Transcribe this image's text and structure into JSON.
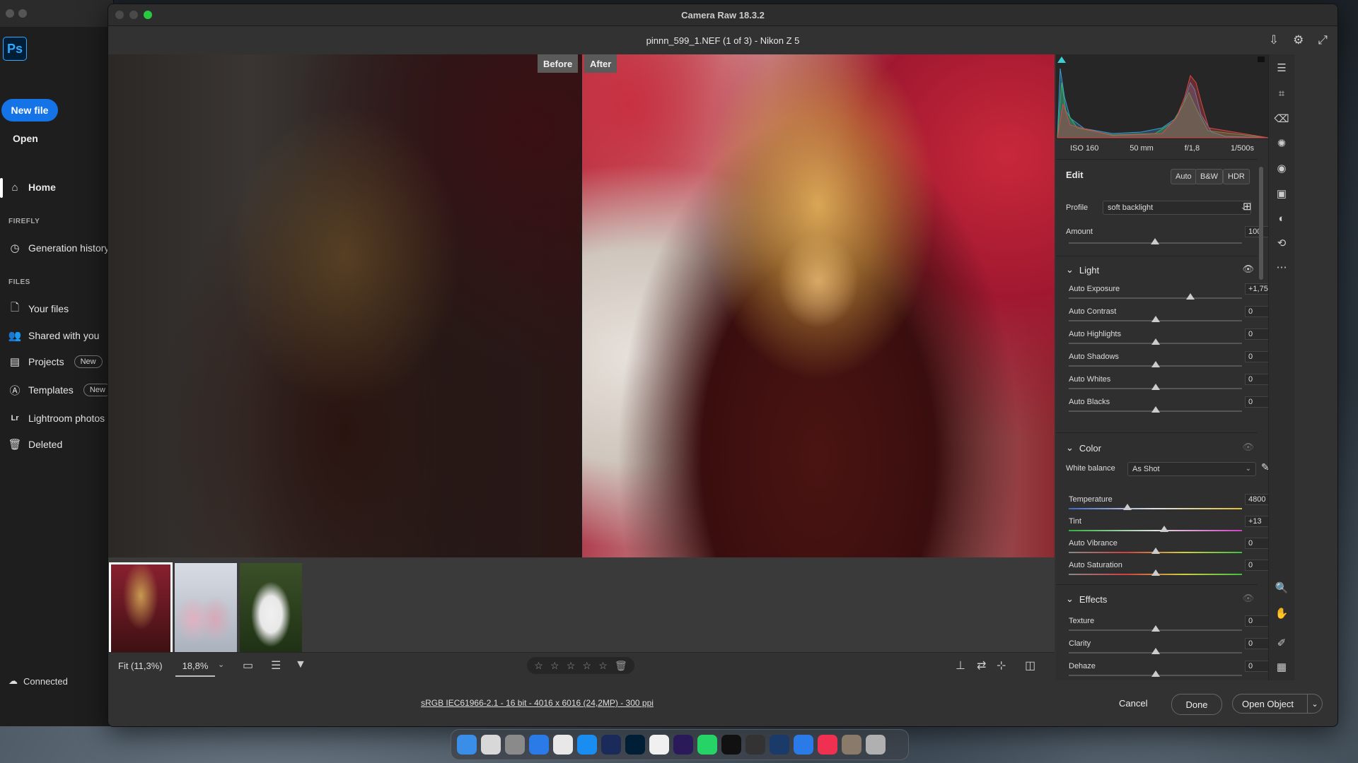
{
  "photoshop": {
    "logo": "Ps",
    "new_file": "New file",
    "open": "Open",
    "home": "Home",
    "section_firefly": "FIREFLY",
    "generation_history": "Generation history",
    "section_files": "FILES",
    "your_files": "Your files",
    "shared_with_you": "Shared with you",
    "projects": "Projects",
    "templates": "Templates",
    "new_badge": "New",
    "lightroom_photos": "Lightroom photos",
    "deleted": "Deleted",
    "connected": "Connected"
  },
  "camera_raw": {
    "window_title": "Camera Raw 18.3.2",
    "file_title": "pinnn_599_1.NEF (1 of 3)  -  Nikon Z 5",
    "before_label": "Before",
    "after_label": "After",
    "fit_label": "Fit (11,3%)",
    "zoom_value": "18,8%",
    "status_link": "sRGB IEC61966-2.1 - 16 bit - 4016 x 6016 (24,2MP) - 300 ppi",
    "cancel": "Cancel",
    "done": "Done",
    "open_object": "Open Object",
    "star_rating": 0
  },
  "exif": {
    "iso": "ISO 160",
    "focal": "50 mm",
    "aperture": "f/1,8",
    "shutter": "1/500s"
  },
  "edit": {
    "title": "Edit",
    "auto": "Auto",
    "bw": "B&W",
    "hdr": "HDR",
    "profile_label": "Profile",
    "profile_value": "soft backlight",
    "amount_label": "Amount",
    "amount_value": "100"
  },
  "light": {
    "title": "Light",
    "sliders": [
      {
        "label": "Auto Exposure",
        "value": "+1,75"
      },
      {
        "label": "Auto Contrast",
        "value": "0"
      },
      {
        "label": "Auto Highlights",
        "value": "0"
      },
      {
        "label": "Auto Shadows",
        "value": "0"
      },
      {
        "label": "Auto Whites",
        "value": "0"
      },
      {
        "label": "Auto Blacks",
        "value": "0"
      }
    ]
  },
  "color": {
    "title": "Color",
    "wb_label": "White balance",
    "wb_value": "As Shot",
    "sliders": [
      {
        "label": "Temperature",
        "value": "4800"
      },
      {
        "label": "Tint",
        "value": "+13"
      },
      {
        "label": "Auto Vibrance",
        "value": "0"
      },
      {
        "label": "Auto Saturation",
        "value": "0"
      }
    ]
  },
  "effects": {
    "title": "Effects",
    "sliders": [
      {
        "label": "Texture",
        "value": "0"
      },
      {
        "label": "Clarity",
        "value": "0"
      },
      {
        "label": "Dehaze",
        "value": "0"
      }
    ]
  },
  "dock": {
    "apps": [
      "Finder",
      "Launchpad",
      "Settings",
      "Safari",
      "Chrome",
      "App Store",
      "LrC",
      "Ps",
      "Notes",
      "Pr",
      "WhatsApp",
      "CapCut",
      "Resolve",
      "Proton",
      "QuickTime",
      "Music",
      "Photos",
      "Trash"
    ]
  }
}
